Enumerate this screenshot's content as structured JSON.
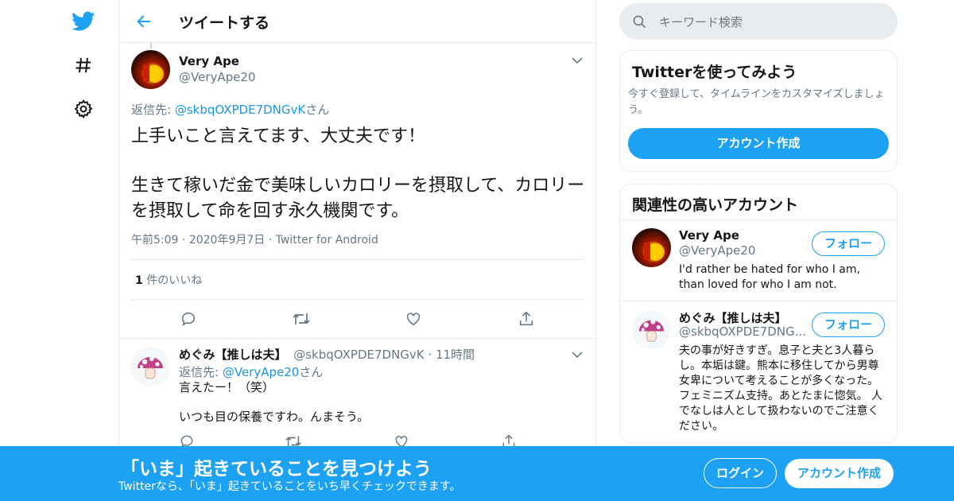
{
  "nav": {
    "icons": [
      "twitter-bird-icon",
      "hashtag-icon",
      "gear-icon"
    ]
  },
  "header": {
    "title": "ツイートする"
  },
  "tweet": {
    "name": "Very Ape",
    "handle": "@VeryApe20",
    "reply_prefix": "返信先: ",
    "reply_to": "@skbqOXPDE7DNGvK",
    "reply_suffix": "さん",
    "text_line1": "上手いこと言えてます、大丈夫です！",
    "text_line2": "生きて稼いだ金で美味しいカロリーを摂取して、カロリーを摂取して命を回す永久機関です。",
    "time": "午前5:09",
    "date": "2020年9月7日",
    "source": "Twitter for Android",
    "likes_count": "1",
    "likes_label": "件のいいね"
  },
  "reply": {
    "name": "めぐみ【推しは夫】",
    "handle": "@skbqOXPDE7DNGvK",
    "time": "11時間",
    "reply_prefix": "返信先: ",
    "reply_to": "@VeryApe20",
    "reply_suffix": "さん",
    "text_line1": "言えたー！（笑）",
    "text_line2": "いつも目の保養ですわ。んまそう。"
  },
  "search": {
    "placeholder": "キーワード検索"
  },
  "signup_card": {
    "title": "Twitterを使ってみよう",
    "desc": "今すぐ登録して、タイムラインをカスタマイズしましょう。",
    "button": "アカウント作成"
  },
  "related": {
    "title": "関連性の高いアカウント",
    "follow_label": "フォロー",
    "accounts": [
      {
        "name": "Very Ape",
        "handle": "@VeryApe20",
        "bio": "I'd rather be hated for who I am, than loved for who I am not."
      },
      {
        "name": "めぐみ【推しは夫】",
        "handle": "@skbqOXPDE7DNG...",
        "bio": "夫の事が好きすぎ。息子と夫と3人暮らし。本垢は鍵。熊本に移住してから男尊女卑について考えることが多くなった。フェミニズム支持。あとたまに惚気。 人でなしは人として扱わないのでご注意ください。"
      }
    ]
  },
  "banner": {
    "headline": "「いま」起きていることを見つけよう",
    "subtext": "Twitterなら、「いま」起きていることをいち早くチェックできます。",
    "login": "ログイン",
    "signup": "アカウント作成"
  },
  "colors": {
    "accent": "#1da1f2",
    "link": "#1b95e0",
    "muted": "#657786",
    "border": "#e6ecf0"
  }
}
